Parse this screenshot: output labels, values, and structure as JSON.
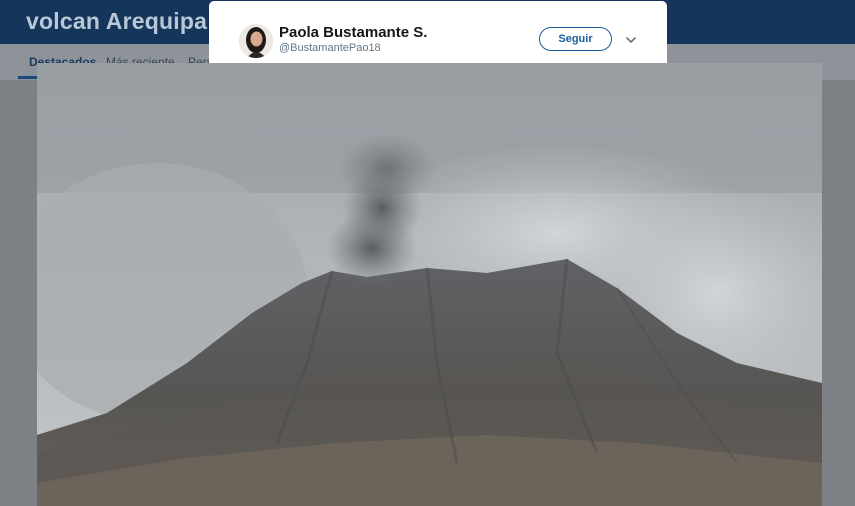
{
  "page": {
    "title": "volcan Arequipa"
  },
  "tabs": [
    {
      "label": "Destacados",
      "active": true
    },
    {
      "label": "Más reciente",
      "active": false
    },
    {
      "label": "Pers",
      "active": false
    }
  ],
  "tweet": {
    "display_name": "Paola Bustamante S.",
    "handle": "@BustamantePao18",
    "follow_label": "Seguir",
    "caret_icon": "chevron-down-icon"
  },
  "colors": {
    "header_bg": "#15365a",
    "accent": "#1b5fa0"
  }
}
